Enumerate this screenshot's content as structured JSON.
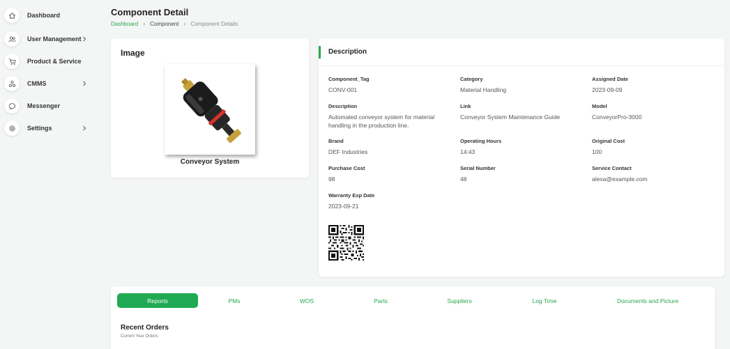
{
  "sidebar": {
    "items": [
      {
        "label": "Dashboard",
        "icon": "home-icon",
        "has_submenu": false
      },
      {
        "label": "User Management",
        "icon": "users-icon",
        "has_submenu": true
      },
      {
        "label": "Product & Service",
        "icon": "cart-icon",
        "has_submenu": false
      },
      {
        "label": "CMMS",
        "icon": "cluster-icon",
        "has_submenu": true
      },
      {
        "label": "Messenger",
        "icon": "chat-icon",
        "has_submenu": false
      },
      {
        "label": "Settings",
        "icon": "gear-icon",
        "has_submenu": true
      }
    ]
  },
  "header": {
    "title": "Component Detail",
    "breadcrumb": [
      "Dashboard",
      "Component",
      "Component Details"
    ]
  },
  "image_card": {
    "title": "Image",
    "caption": "Conveyor System"
  },
  "description": {
    "title": "Description",
    "fields": [
      {
        "label": "Component_Tag",
        "value": "CONV-001"
      },
      {
        "label": "Category",
        "value": "Material Handling"
      },
      {
        "label": "Assigned Date",
        "value": "2023-09-09"
      },
      {
        "label": "Description",
        "value": "Automated conveyor system for material handling in the production line."
      },
      {
        "label": "Link",
        "value": "Conveyor System Maintenance Guide"
      },
      {
        "label": "Model",
        "value": "ConveyorPro-3000"
      },
      {
        "label": "Brand",
        "value": "DEF Industries"
      },
      {
        "label": "Operating Hours",
        "value": "14:43"
      },
      {
        "label": "Original Cost",
        "value": "100"
      },
      {
        "label": "Purchase Cost",
        "value": "98"
      },
      {
        "label": "Serial Number",
        "value": "48"
      },
      {
        "label": "Service Contact",
        "value": "alexa@example.com"
      },
      {
        "label": "Warranty Exp Date",
        "value": "2023-09-21"
      }
    ]
  },
  "tabs": {
    "active_index": 0,
    "items": [
      "Reports",
      "PMs",
      "WOS",
      "Parts",
      "Suppliers",
      "Log Time",
      "Documents and Picture"
    ]
  },
  "orders": {
    "title": "Recent Orders",
    "subtitle": "Current Year Orders"
  },
  "colors": {
    "accent": "#1faa53",
    "link": "#27a84f",
    "background": "#f4f6f5"
  }
}
